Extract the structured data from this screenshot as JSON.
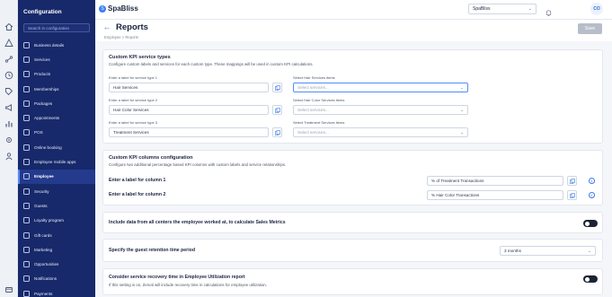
{
  "app": {
    "logo_mark": "S",
    "logo_name": "SpaBliss",
    "site": "SpaBliss",
    "avatar_initials": "CO"
  },
  "rail_icons": [
    "home-icon",
    "calendar-icon",
    "graph-icon",
    "clock-icon",
    "tag-icon",
    "megaphone-icon",
    "chart-icon",
    "gear-icon",
    "users-icon",
    "billing-icon"
  ],
  "sidebar": {
    "title": "Configuration",
    "search_placeholder": "Search in configuration",
    "items": [
      {
        "label": "Business details"
      },
      {
        "label": "Services"
      },
      {
        "label": "Products"
      },
      {
        "label": "Memberships"
      },
      {
        "label": "Packages"
      },
      {
        "label": "Appointments"
      },
      {
        "label": "POS"
      },
      {
        "label": "Online booking"
      },
      {
        "label": "Employee mobile apps"
      },
      {
        "label": "Employee"
      },
      {
        "label": "Security"
      },
      {
        "label": "Guests"
      },
      {
        "label": "Loyalty program"
      },
      {
        "label": "Gift cards"
      },
      {
        "label": "Marketing"
      },
      {
        "label": "Opportunities"
      },
      {
        "label": "Notifications"
      },
      {
        "label": "Payments"
      }
    ],
    "active_index": 9
  },
  "page": {
    "title": "Reports",
    "breadcrumb": "Employee  >  Reports",
    "save_label": "Save"
  },
  "kpi_types": {
    "title": "Custom KPI service types",
    "subtitle": "Configure custom labels and services for each custom type. These mappings will be used in custom KPI calculations.",
    "rows": [
      {
        "label_caption": "Enter a label for service type 1",
        "label_value": "Hair Services",
        "items_caption": "Select Hair Services items",
        "items_placeholder": "Select services..."
      },
      {
        "label_caption": "Enter a label for service type 2",
        "label_value": "Hair Color Services",
        "items_caption": "Select Hair Color Services items",
        "items_placeholder": "Select services..."
      },
      {
        "label_caption": "Enter a label for service type 3",
        "label_value": "Treatment Services",
        "items_caption": "Select Treatment Services items",
        "items_placeholder": "Select services..."
      }
    ]
  },
  "kpi_columns": {
    "title": "Custom KPI columns configuration",
    "subtitle": "Configure two additional percentage based KPI columns with custom labels and service relationships.",
    "rows": [
      {
        "label": "Enter a label for column 1",
        "value": "% of Treatment Transactions"
      },
      {
        "label": "Enter a label for column 2",
        "value": "% Hair Color Transactions"
      }
    ]
  },
  "sales_metrics": {
    "label": "Include data from all centers the employee worked at, to calculate Sales Metrics",
    "enabled": false
  },
  "retention": {
    "label": "Specify the guest retention time period",
    "value": "3 months"
  },
  "recovery": {
    "label": "Consider service recovery time in Employee Utilization report",
    "subtitle": "If this setting is on, Zenoti will include recovery time in calculations for employee utilization.",
    "enabled": false
  }
}
